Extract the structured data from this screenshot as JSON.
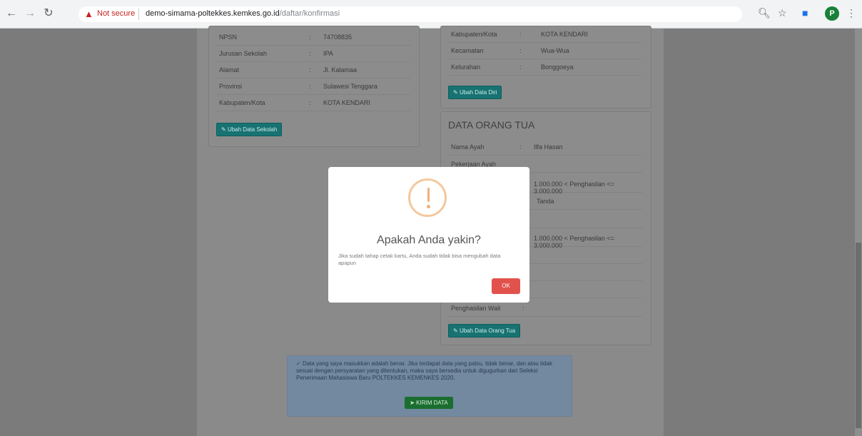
{
  "browser": {
    "security_label": "Not secure",
    "url_host": "demo-simama-poltekkes.kemkes.go.id",
    "url_path": "/daftar/konfirmasi",
    "profile_initial": "P"
  },
  "sekolah": {
    "rows": [
      {
        "label": "NPSN",
        "value": "74708835"
      },
      {
        "label": "Jurusan Sekolah",
        "value": "IPA"
      },
      {
        "label": "Alamat",
        "value": "Jl. Kalamaa"
      },
      {
        "label": "Provinsi",
        "value": "Sulawesi Tenggara"
      },
      {
        "label": "Kabupaten/Kota",
        "value": "KOTA KENDARI"
      }
    ],
    "edit_label": "Ubah Data Sekolah"
  },
  "diri": {
    "rows": [
      {
        "label": "Kabupaten/Kota",
        "value": "KOTA KENDARI"
      },
      {
        "label": "Kecamatan",
        "value": "Wua-Wua"
      },
      {
        "label": "Kelurahan",
        "value": "Bonggoeya"
      }
    ],
    "edit_label": "Ubah Data Diri"
  },
  "orang_tua": {
    "title": "DATA ORANG TUA",
    "rows": [
      {
        "label": "Nama Ayah",
        "value": "Ilfa Hasan"
      },
      {
        "label": "Pekerjaan Ayah",
        "value": ""
      },
      {
        "label": "",
        "value": "1.000.000 < Penghasilan <= 3.000.000"
      },
      {
        "label": "",
        "value": "Tanda"
      },
      {
        "label": "",
        "value": ""
      },
      {
        "label": "",
        "value": "1.000.000 < Penghasilan <= 3.000.000"
      },
      {
        "label": "",
        "value": ""
      },
      {
        "label": "",
        "value": ""
      },
      {
        "label": "",
        "value": ""
      },
      {
        "label": "Penghasilan Wali",
        "value": ""
      }
    ],
    "edit_label": "Ubah Data Orang Tua"
  },
  "notice": {
    "text": "Data yang saya masukkan adalah benar. Jika terdapat data yang palsu, tidak benar, dan atau tidak sesuai dengan persyaratan yang ditentukan, maka saya bersedia untuk digugurkan dari Seleksi Penerimaan Mahasiswa Baru POLTEKKES KEMENKES 2020.",
    "check_mark": "✓",
    "submit_label": "KIRIM DATA"
  },
  "modal": {
    "title": "Apakah Anda yakin?",
    "text": "Jika sudah tahap cetak kartu, Anda sudah tidak bisa mengubah data apapun",
    "ok_label": "OK"
  }
}
